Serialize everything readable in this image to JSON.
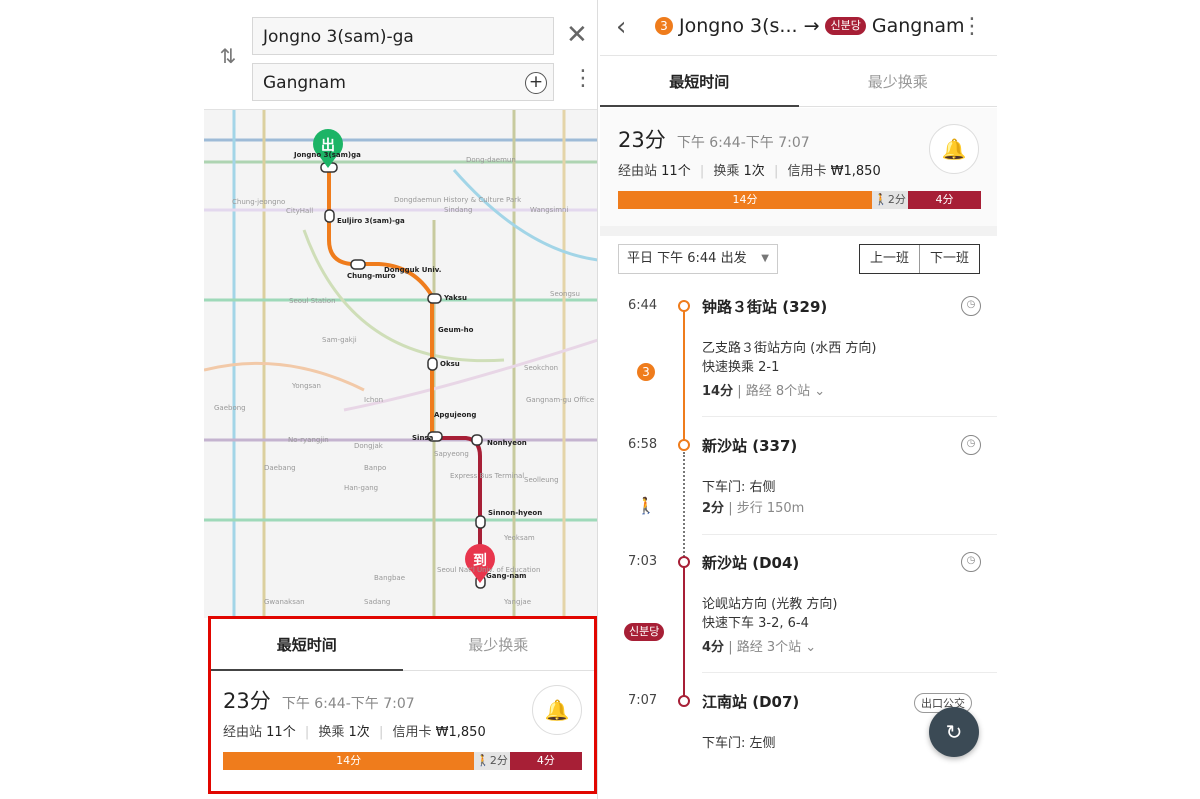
{
  "left": {
    "search": {
      "from_value": "Jongno 3(sam)-ga",
      "to_value": "Gangnam",
      "add_symbol": "+",
      "close_symbol": "✕",
      "more_symbol": "⋮",
      "swap_symbol": "⇅"
    },
    "map": {
      "start_pin": "出",
      "end_pin": "到",
      "labels": {
        "jongno": "Jongno 3(sam)ga",
        "euljiro": "Euljiro 3(sam)-ga",
        "chungmuro": "Chung-muro",
        "dongguk": "Dongguk Univ.",
        "yaksu": "Yaksu",
        "geumho": "Geum-ho",
        "oksu": "Oksu",
        "apgujeong": "Apgujeong",
        "sinsa": "Sinsa",
        "nonhyeon": "Nonhyeon",
        "sinnonhyeon": "Sinnon-hyeon",
        "gangnam": "Gang-nam",
        "seoul_station": "Seoul Station",
        "express_bus": "Express Bus Terminal",
        "seoul_national_univ": "Seoul Nat'l Univ. of Education",
        "hangang": "Han-gang",
        "cityhall": "CityHall",
        "chungjeongno": "Chung-jeongno",
        "dongdaemun": "Dongdaemun History & Culture Park",
        "sindang": "Sindang",
        "wangsimni": "Wangsimni",
        "seongsu": "Seongsu",
        "samgakji": "Sam-gakji",
        "yongsan": "Yongsan",
        "ichon": "Ichon",
        "dongjak": "Dongjak",
        "banpo": "Banpo",
        "sapyeong": "Sapyeong",
        "gaebong": "Gaebong",
        "daebang": "Daebang",
        "noryangjin": "No-ryangjin",
        "seokchon": "Seokchon",
        "gangnam_gu": "Gangnam-gu Office",
        "seolleung": "Seolleung",
        "yeoksam": "Yeoksam",
        "yangjae": "Yangjae",
        "gwanaksan": "Gwanaksan",
        "bangbae": "Bangbae",
        "sadang": "Sadang",
        "dongdaemun_gate": "Dong-daemun"
      }
    },
    "card": {
      "tab_fastest": "最短时间",
      "tab_fewest": "最少换乘",
      "duration": "23分",
      "time_range": "下午 6:44-下午 7:07",
      "stations_label": "经由站",
      "stations_value": "11个",
      "transfer_label": "换乘",
      "transfer_value": "1次",
      "fare_label": "信用卡",
      "fare_value": "₩1,850",
      "bell": "🔔",
      "seg1": "14分",
      "seg2": "🚶2分",
      "seg3": "4分"
    }
  },
  "right": {
    "header": {
      "back": "‹",
      "line_number": "3",
      "from": "Jongno 3(s...",
      "arrow": "→",
      "line_badge": "신분당",
      "to": "Gangnam",
      "more": "⋮"
    },
    "tabs": {
      "fastest": "最短时间",
      "fewest": "最少换乘"
    },
    "summary": {
      "duration": "23分",
      "time_range": "下午 6:44-下午 7:07",
      "stations_label": "经由站",
      "stations_value": "11个",
      "transfer_label": "换乘",
      "transfer_value": "1次",
      "fare_label": "信用卡",
      "fare_value": "₩1,850",
      "bell": "🔔",
      "seg1": "14分",
      "seg2": "🚶2分",
      "seg3": "4分"
    },
    "departure": {
      "select_value": "平日 下午 6:44 出发",
      "caret": "▼",
      "prev": "上一班",
      "next": "下一班"
    },
    "steps": {
      "s1_time": "6:44",
      "s1_station": "钟路３街站 (329)",
      "s1_dir": "乙支路３街站方向 (水西 方向)",
      "s1_fast": "快速换乘 2-1",
      "s1_mins": "14分",
      "s1_via": "路经 8个站",
      "s1_line": "3",
      "s2_time": "6:58",
      "s2_station": "新沙站 (337)",
      "s2_exit": "下车门: 右侧",
      "s2_mins": "2分",
      "s2_walk": "步行 150m",
      "s3_time": "7:03",
      "s3_station": "新沙站 (D04)",
      "s3_dir": "论岘站方向 (光教 方向)",
      "s3_fast": "快速下车 3-2, 6-4",
      "s3_mins": "4分",
      "s3_via": "路经 3个站",
      "s3_line": "신분당",
      "s4_time": "7:07",
      "s4_station": "江南站 (D07)",
      "s4_exit_bus": "出口公交",
      "s4_door": "下车门: 左侧",
      "clock": "◷",
      "chevron": "⌄",
      "walk_icon": "🚶",
      "refresh": "↻"
    }
  },
  "colors": {
    "line3": "#ef7c1c",
    "shinbundang": "#a71f36",
    "highlight_border": "#e10600"
  }
}
